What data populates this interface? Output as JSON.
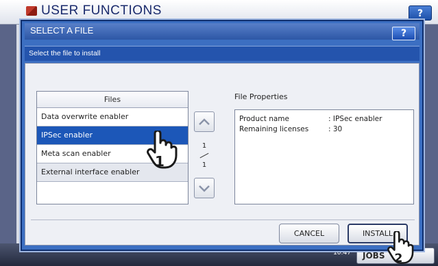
{
  "background": {
    "title": "USER FUNCTIONS",
    "help_label": "?",
    "clock_label": "10:47",
    "jobs_label": "JOBS"
  },
  "dialog": {
    "title": "SELECT A FILE",
    "help_label": "?",
    "instruction": "Select the file to install"
  },
  "files": {
    "header": "Files",
    "items": [
      {
        "label": "Data overwrite enabler"
      },
      {
        "label": "IPSec enabler"
      },
      {
        "label": "Meta scan enabler"
      },
      {
        "label": "External interface enabler"
      }
    ],
    "selected_index": 1
  },
  "pagination": {
    "current": "1",
    "total": "1"
  },
  "properties": {
    "label": "File Properties",
    "rows": [
      {
        "key": "Product name",
        "value": ": IPSec enabler"
      },
      {
        "key": "Remaining licenses",
        "value": ": 30"
      }
    ]
  },
  "buttons": {
    "cancel": "CANCEL",
    "install": "INSTALL"
  },
  "callouts": {
    "step1": "1",
    "step2": "2"
  },
  "colors": {
    "dialog_blue": "#3c6fc2",
    "selected_row": "#1c57b8",
    "subbar_blue": "#2454ad"
  }
}
